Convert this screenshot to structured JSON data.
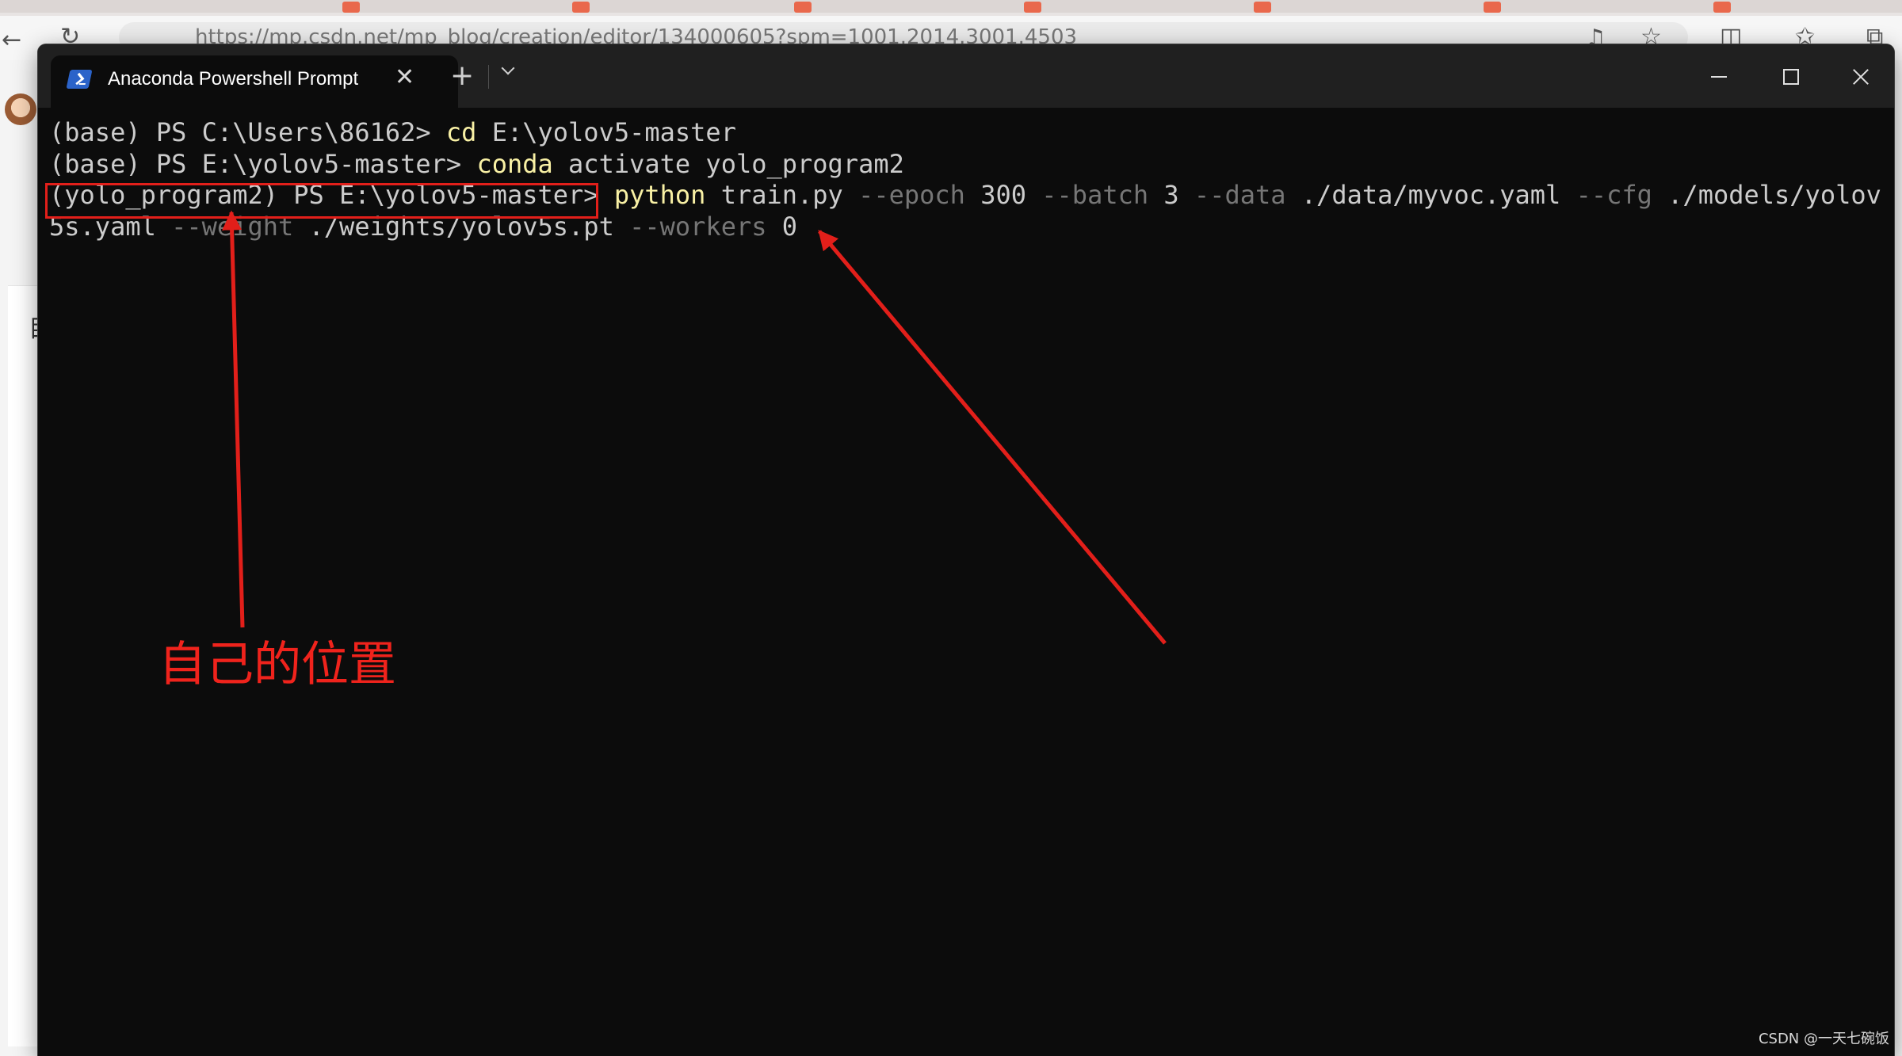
{
  "browser": {
    "address_url": "https://mp.csdn.net/mp_blog/creation/editor/134000605?spm=1001.2014.3001.4503",
    "left_panel_char": "目"
  },
  "terminal": {
    "tab_title": "Anaconda Powershell Prompt",
    "tab_close_glyph": "✕",
    "new_tab_glyph": "+",
    "lines": [
      {
        "segments": [
          {
            "text": "(base) PS C:\\Users\\86162> ",
            "style": "plain"
          },
          {
            "text": "cd",
            "style": "cmd"
          },
          {
            "text": " E:\\yolov5-master",
            "style": "plain"
          }
        ]
      },
      {
        "segments": [
          {
            "text": "(base) PS E:\\yolov5-master> ",
            "style": "plain"
          },
          {
            "text": "conda",
            "style": "cmd"
          },
          {
            "text": " activate yolo_program2",
            "style": "plain"
          }
        ]
      },
      {
        "segments": [
          {
            "text": "(yolo_program2) PS E:\\yolov5-master> ",
            "style": "plain"
          },
          {
            "text": "python",
            "style": "cmd"
          },
          {
            "text": " train.py ",
            "style": "plain"
          },
          {
            "text": "--epoch",
            "style": "param"
          },
          {
            "text": " 300 ",
            "style": "plain"
          },
          {
            "text": "--batch",
            "style": "param"
          },
          {
            "text": " 3 ",
            "style": "plain"
          },
          {
            "text": "--data",
            "style": "param"
          },
          {
            "text": " ./data/myvoc.yaml ",
            "style": "plain"
          },
          {
            "text": "--cfg",
            "style": "param"
          },
          {
            "text": " ./models/yolov",
            "style": "plain"
          }
        ]
      },
      {
        "segments": [
          {
            "text": "5s.yaml ",
            "style": "plain"
          },
          {
            "text": "--weight",
            "style": "param"
          },
          {
            "text": " ./weights/yolov5s.pt ",
            "style": "plain"
          },
          {
            "text": "--workers",
            "style": "param"
          },
          {
            "text": " 0",
            "style": "plain"
          }
        ]
      }
    ]
  },
  "annotation": {
    "label": "自己的位置",
    "color": "#f0231c"
  },
  "watermark": "CSDN @一天七碗饭",
  "colors": {
    "terminal_bg": "#0c0c0c",
    "command": "#f9f1a5",
    "parameter": "#767676",
    "text": "#cccccc",
    "annotation_red": "#e21f1a"
  }
}
